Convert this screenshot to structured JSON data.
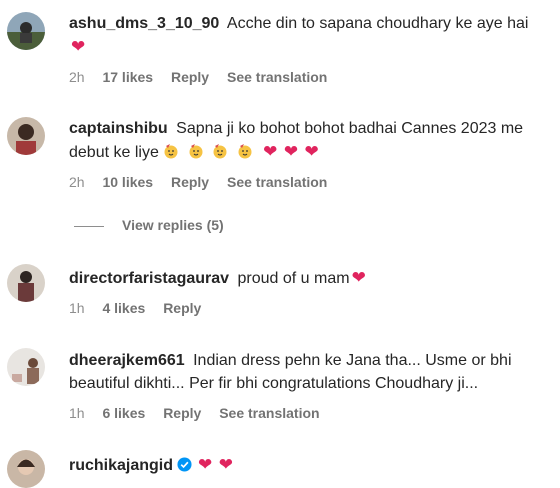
{
  "comments": [
    {
      "username": "ashu_dms_3_10_90",
      "text": "Acche din to sapana choudhary ke aye hai",
      "time": "2h",
      "likes": "17 likes",
      "reply": "Reply",
      "translate": "See translation"
    },
    {
      "username": "captainshibu",
      "text": "Sapna ji ko bohot bohot badhai Cannes 2023 me debut ke liye",
      "time": "2h",
      "likes": "10 likes",
      "reply": "Reply",
      "translate": "See translation"
    },
    {
      "username": "directorfaristagaurav",
      "text": "proud of u mam",
      "time": "1h",
      "likes": "4 likes",
      "reply": "Reply"
    },
    {
      "username": "dheerajkem661",
      "text": "Indian dress pehn ke Jana tha... Usme or bhi beautiful dikhti... Per fir bhi congratulations Choudhary ji...",
      "time": "1h",
      "likes": "6 likes",
      "reply": "Reply",
      "translate": "See translation"
    },
    {
      "username": "ruchikajangid",
      "text": ""
    }
  ],
  "view_replies": "View replies (5)",
  "icons": {
    "heart": "heart-icon",
    "party": "partying-face-icon",
    "verified": "verified-badge-icon"
  },
  "colors": {
    "heart": "#e0245e",
    "verified": "#0095f6",
    "meta": "#737373"
  }
}
